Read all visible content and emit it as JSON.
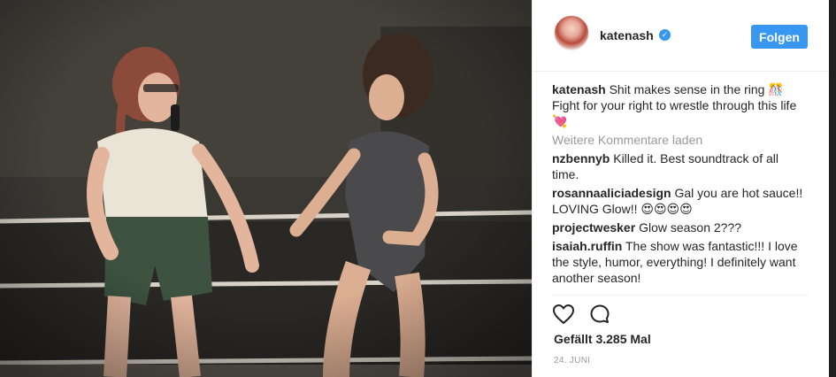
{
  "post": {
    "photo_alt": "photo",
    "author": {
      "username": "katenash",
      "verified_mark": "✓",
      "follow_label": "Folgen"
    },
    "comments": [
      {
        "user": "katenash",
        "text": "Shit makes sense in the ring 🎊 Fight for your right to wrestle through this life 💘"
      },
      {
        "user": "nzbennyb",
        "text": "Killed it. Best soundtrack of all time."
      },
      {
        "user": "rosannaaliciadesign",
        "text": "Gal you are hot sauce!! LOVING Glow!! 😍😍😍😍"
      },
      {
        "user": "projectwesker",
        "text": "Glow season 2???"
      },
      {
        "user": "isaiah.ruffin",
        "text": "The show was fantastic!!! I love the style, humor, everything! I definitely want another season!"
      }
    ],
    "load_more_label": "Weitere Kommentare laden",
    "likes_text": "Gefällt 3.285 Mal",
    "date_text": "24. JUNI"
  },
  "icons": {
    "like": "heart-icon",
    "comment": "comment-icon",
    "verified": "verified-badge-icon"
  },
  "colors": {
    "accent": "#3897f0",
    "text": "#262626",
    "muted": "#999999",
    "border": "#efefef"
  }
}
